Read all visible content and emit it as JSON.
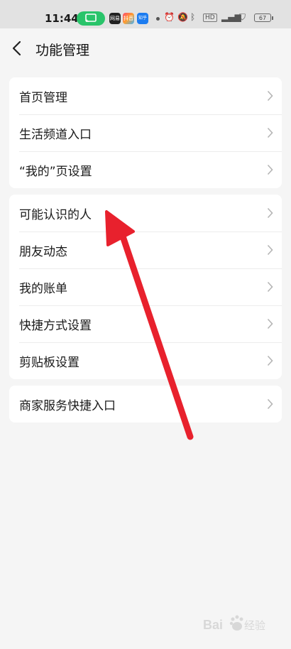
{
  "status_bar": {
    "time": "11:44",
    "app_icons": [
      "网易",
      "抖音",
      "知乎"
    ],
    "battery": "67"
  },
  "header": {
    "title": "功能管理"
  },
  "groups": [
    {
      "items": [
        {
          "label": "首页管理"
        },
        {
          "label": "生活频道入口"
        },
        {
          "label": "“我的”页设置"
        }
      ]
    },
    {
      "items": [
        {
          "label": "可能认识的人"
        },
        {
          "label": "朋友动态"
        },
        {
          "label": "我的账单"
        },
        {
          "label": "快捷方式设置"
        },
        {
          "label": "剪贴板设置"
        }
      ]
    },
    {
      "items": [
        {
          "label": "商家服务快捷入口"
        }
      ]
    }
  ],
  "colors": {
    "background": "#f5f5f5",
    "card": "#ffffff",
    "annotation_arrow": "#e8212d"
  }
}
